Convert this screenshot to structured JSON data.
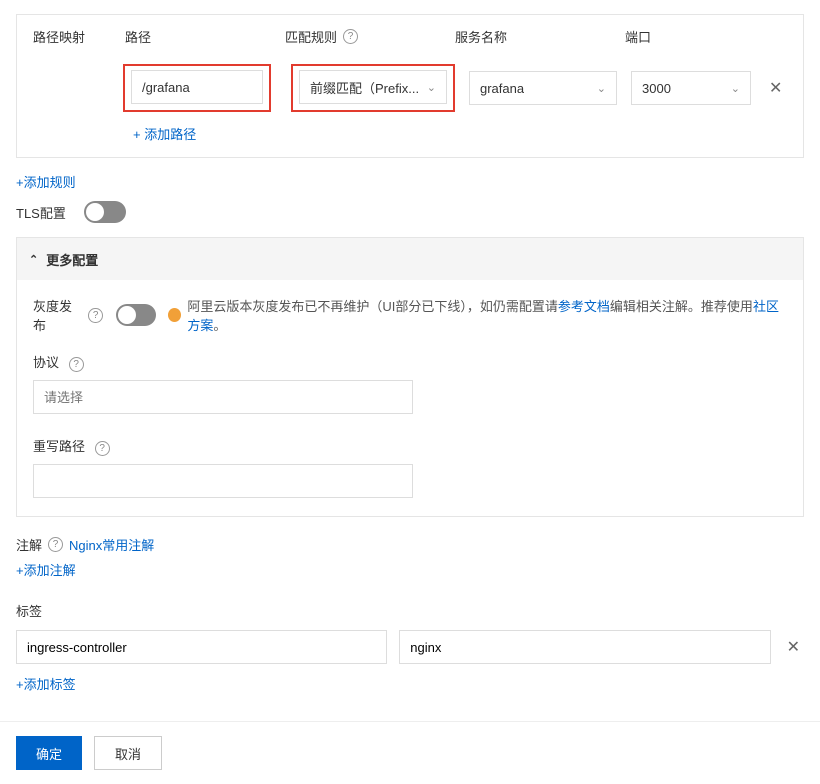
{
  "headers": {
    "mapping": "路径映射",
    "path": "路径",
    "rule": "匹配规则",
    "service": "服务名称",
    "port": "端口"
  },
  "path_row": {
    "path_value": "/grafana",
    "rule_value": "前缀匹配（Prefix...",
    "service_value": "grafana",
    "port_value": "3000"
  },
  "add_path": "+  添加路径",
  "add_rule": "+添加规则",
  "tls_label": "TLS配置",
  "more": {
    "header": "更多配置"
  },
  "gray": {
    "label": "灰度发布",
    "warn_prefix": "阿里云版本灰度发布已不再维护（UI部分已下线），如仍需配置请",
    "doc_link": "参考文档",
    "warn_mid": "编辑相关注解。推荐使用",
    "community_link": "社区方案",
    "suffix": "。"
  },
  "protocol": {
    "label": "协议",
    "placeholder": "请选择"
  },
  "rewrite": {
    "label": "重写路径"
  },
  "annotate": {
    "label": "注解",
    "link": "Nginx常用注解",
    "add": "+添加注解"
  },
  "tags": {
    "label": "标签",
    "key": "ingress-controller",
    "value": "nginx",
    "add": "+添加标签"
  },
  "footer": {
    "ok": "确定",
    "cancel": "取消"
  }
}
